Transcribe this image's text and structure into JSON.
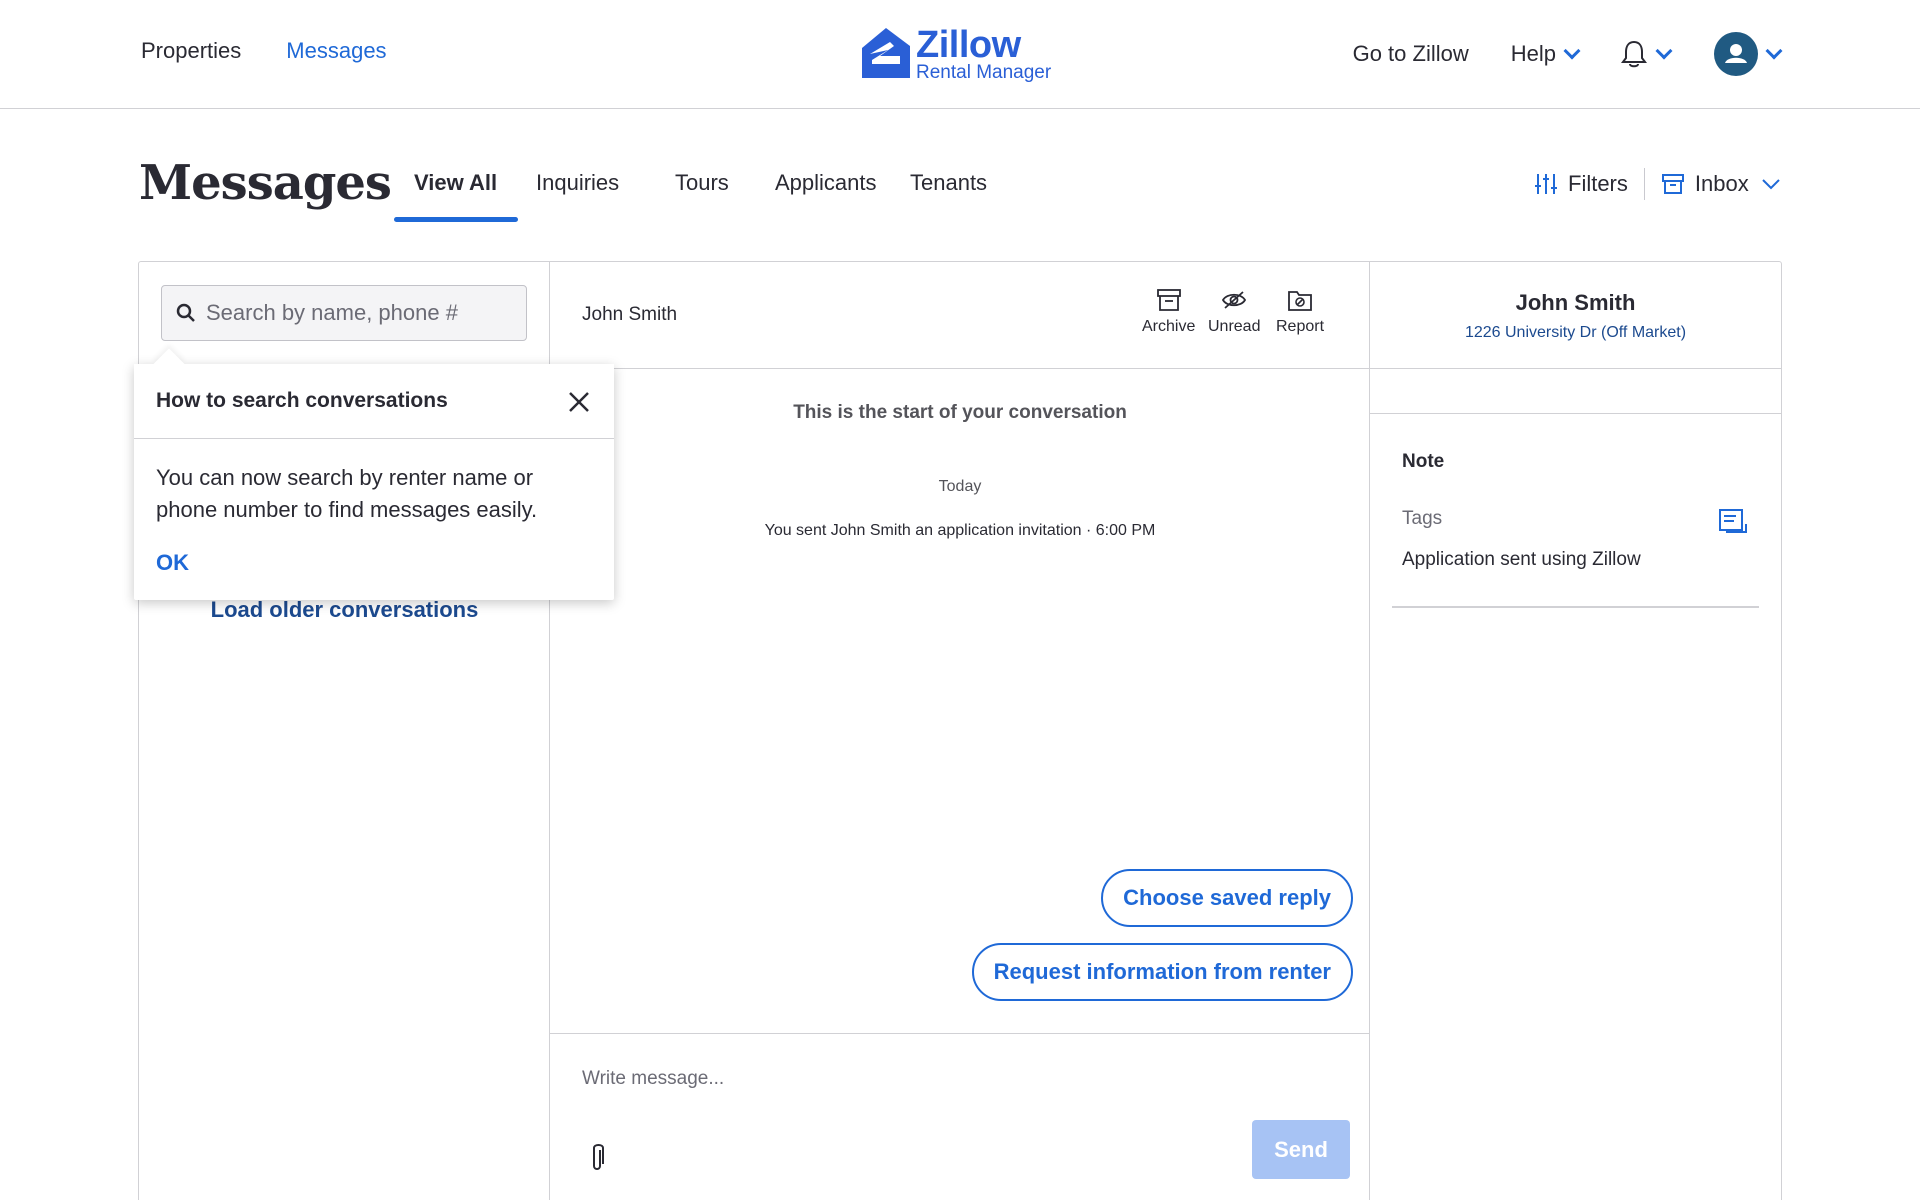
{
  "nav": {
    "properties": "Properties",
    "messages": "Messages",
    "go_to_zillow": "Go to Zillow",
    "help": "Help",
    "notifications_icon": "bell-icon",
    "account_icon": "user-avatar-icon"
  },
  "logo": {
    "brand": "Zillow",
    "product": "Rental Manager"
  },
  "page": {
    "title": "Messages",
    "tabs": [
      {
        "label": "View All",
        "active": true
      },
      {
        "label": "Inquiries",
        "active": false
      },
      {
        "label": "Tours",
        "active": false
      },
      {
        "label": "Applicants",
        "active": false
      },
      {
        "label": "Tenants",
        "active": false
      }
    ],
    "filters_label": "Filters",
    "inbox_label": "Inbox"
  },
  "left": {
    "search_placeholder": "Search by name, phone #",
    "load_older": "Load older conversations"
  },
  "popover": {
    "title": "How to search conversations",
    "body": "You can now search by renter name or phone number to find messages easily.",
    "ok": "OK"
  },
  "conversation": {
    "contact_name": "John Smith",
    "actions": {
      "archive": "Archive",
      "unread": "Unread",
      "report": "Report"
    },
    "start_text": "This is the start of your conversation",
    "day_label": "Today",
    "event_text": "You sent John Smith an application invitation · 6:00 PM",
    "choose_saved_reply": "Choose saved reply",
    "request_info": "Request information from renter",
    "composer_placeholder": "Write message...",
    "send": "Send"
  },
  "details": {
    "name": "John Smith",
    "address": "1226 University Dr (Off Market)",
    "note_label": "Note",
    "tags_label": "Tags",
    "tag_value": "Application sent using Zillow"
  },
  "colors": {
    "accent": "#1f69d7",
    "dark_link": "#1c4a8f",
    "send_disabled": "#a7c3f4"
  }
}
